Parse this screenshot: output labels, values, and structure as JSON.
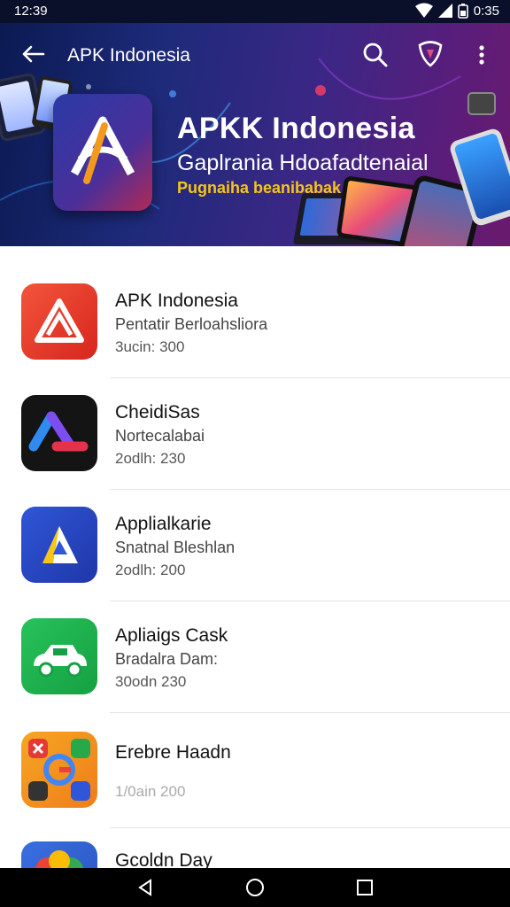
{
  "status_bar": {
    "time": "12:39",
    "clock_right": "0:35"
  },
  "app_bar": {
    "title": "APK Indonesia",
    "icons": [
      "back-arrow-icon",
      "search-icon",
      "shield-icon",
      "more-vert-icon"
    ]
  },
  "hero": {
    "title": "APKK Indonesia",
    "subtitle": "Gaplrania Hdoafadtenaial",
    "tagline": "Pugnaiha beanibabak"
  },
  "apps": [
    {
      "name": "APK Indonesia",
      "desc": "Pentatir Berloahsliora",
      "size": "3ucin: 300",
      "icon": "apk-indonesia-icon",
      "color": "#e8362a"
    },
    {
      "name": "CheidiSas",
      "desc": "Nortecalabai",
      "size": "2odlh: 230",
      "icon": "cheidisas-icon",
      "color": "#111111"
    },
    {
      "name": "Applialkarie",
      "desc": "Snatnal Bleshlan",
      "size": "2odlh: 200",
      "icon": "applialkarie-icon",
      "color": "#2946c5"
    },
    {
      "name": "Apliaigs Cask",
      "desc": "Bradalra Dam:",
      "size": "30odn 230",
      "icon": "apliaigs-cask-icon",
      "color": "#1fb34f"
    },
    {
      "name": "Erebre Haadn",
      "desc": "",
      "size": "1/0ain 200",
      "icon": "erebre-haadn-icon",
      "color": "#f0a030"
    },
    {
      "name": "Gcoldn Day",
      "desc": "",
      "size": "",
      "icon": "gcoldn-day-icon",
      "color": "#3a6fe0"
    }
  ],
  "nav_bar": {
    "icons": [
      "back-triangle-icon",
      "home-circle-icon",
      "recents-square-icon"
    ]
  }
}
